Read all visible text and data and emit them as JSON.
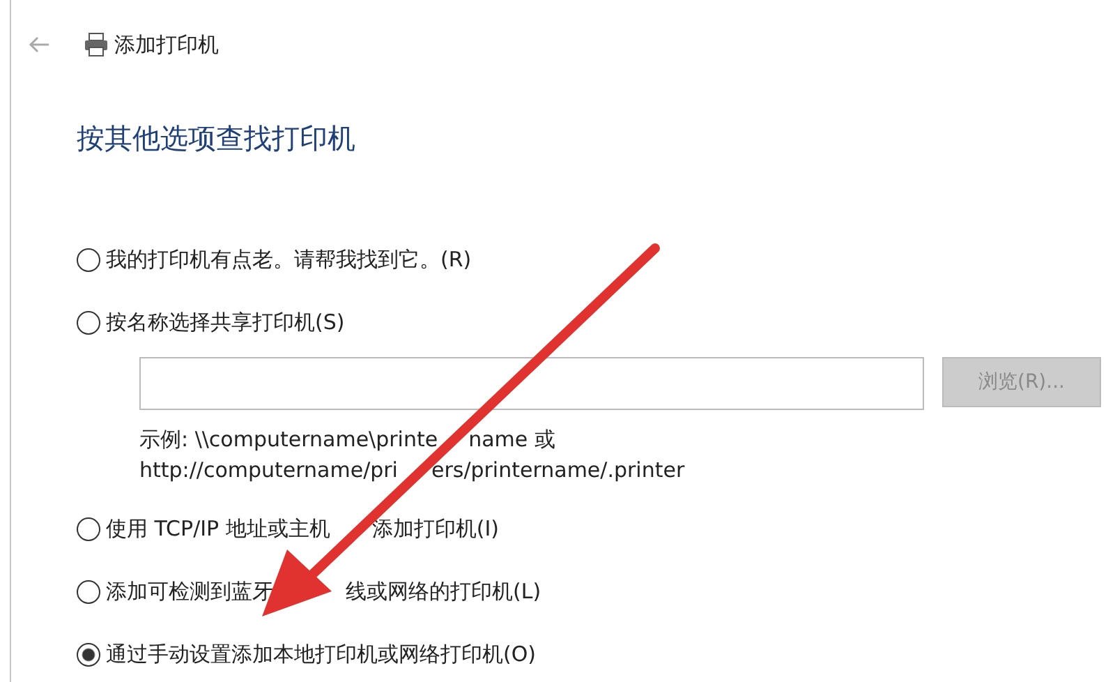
{
  "window": {
    "title": "添加打印机"
  },
  "heading": "按其他选项查找打印机",
  "options": [
    {
      "label_parts": [
        "我的打印机有点老。请帮我找到它。(R)"
      ],
      "selected": false
    },
    {
      "label_parts": [
        "按名称选择共享打印机(S)"
      ],
      "selected": false,
      "share_field": {
        "disabled": false
      },
      "browse_button": {
        "label": "浏览(R)...",
        "disabled": true
      },
      "example": [
        [
          "示例: \\\\computername\\printe",
          "name 或"
        ],
        [
          "http://computername/pri",
          "ers/printername/.printer"
        ]
      ]
    },
    {
      "label_parts": [
        "使用 TCP/IP 地址或主机",
        "添加打印机(I)"
      ],
      "selected": false
    },
    {
      "label_parts": [
        "添加可检测到蓝牙",
        "线或网络的打印机(L)"
      ],
      "selected": false
    },
    {
      "label_parts": [
        "通过手动设置添加本地打印机或网络打印机(O)"
      ],
      "selected": true
    }
  ]
}
